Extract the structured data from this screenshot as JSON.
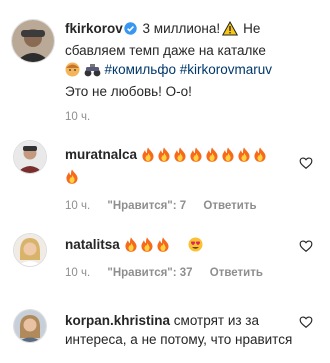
{
  "caption": {
    "username": "fkirkorov",
    "line1_text": "3 миллиона!",
    "line1_rest": "Не",
    "line2": "сбавляем темп даже на каталке",
    "hashtags": "#комильфо #kirkorovmaruv",
    "line4": "Это не любовь! О-о!",
    "time": "10 ч."
  },
  "comments": [
    {
      "username": "muratnalca",
      "time": "10 ч.",
      "likes": "\"Нравится\": 7",
      "reply": "Ответить"
    },
    {
      "username": "natalitsa",
      "time": "10 ч.",
      "likes": "\"Нравится\": 37",
      "reply": "Ответить"
    },
    {
      "username": "korpan.khristina",
      "text": "смотрят из за интереса, а не потому, что нравится"
    }
  ],
  "colors": {
    "text": "#262626",
    "muted": "#8e8e8e",
    "link": "#00376b",
    "verified": "#3897f0"
  }
}
